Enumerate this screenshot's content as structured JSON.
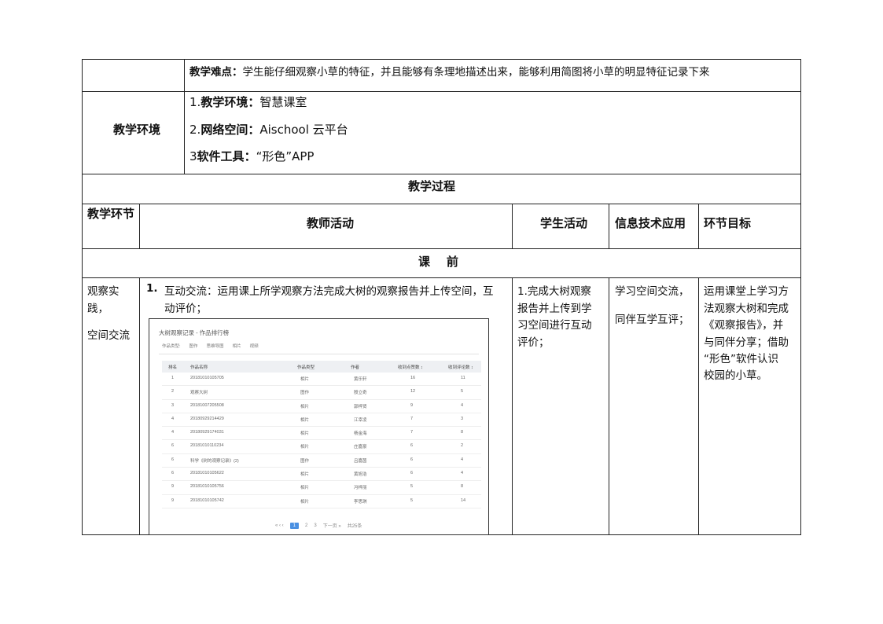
{
  "difficulty": {
    "label": "教学难点：",
    "text": "学生能仔细观察小草的特征，并且能够有条理地描述出来，能够利用简图将小草的明显特征记录下来"
  },
  "environment": {
    "header": "教学环境",
    "items": [
      {
        "prefix": "1.",
        "label": "教学环境",
        "sep": "：",
        "value": "智慧课室"
      },
      {
        "prefix": "2.",
        "label": "网络空间",
        "sep": "：",
        "value": "Aischool 云平台"
      },
      {
        "prefix": "3",
        "label": "软件工具",
        "sep": "：",
        "value": "“形色”APP"
      }
    ]
  },
  "process_title": "教学过程",
  "columns": [
    "教学环节",
    "教师活动",
    "学生活动",
    "信息技术应用",
    "环节目标"
  ],
  "section": "课    前",
  "row": {
    "stage_line1": "观察实",
    "stage_line2": "践，",
    "stage_line3": "空间交流",
    "teacher_num": "1.",
    "teacher_text_line1": "互动交流：运用课上所学观察方法完成大树的观察报告并上传空间，互",
    "teacher_text_line2": "动评价；",
    "student_lines": [
      "1.完成大树观察",
      "报告并上传到学",
      "习空间进行互动",
      "评价；"
    ],
    "tech_line1": "学习空间交流，",
    "tech_line2": "同伴互学互评；",
    "goal_lines": [
      "运用课堂上学习方",
      "法观察大树和完成",
      "《观察报告》，并",
      "与同伴分享；借助",
      "“形色”软件认识",
      "校园的小草。"
    ]
  },
  "screenshot": {
    "title": "大树观察记录 - 作品排行榜",
    "filters": [
      "作品类型:",
      "图作",
      "思维导图",
      "相片",
      "视频"
    ],
    "headers": [
      "排名",
      "作品名称",
      "作品类型",
      "作者",
      "收到点赞数 ↕",
      "收到评论数 ↕"
    ],
    "rows": [
      [
        "1",
        "20181010105705",
        "相片",
        "黄乐轩",
        "16",
        "11"
      ],
      [
        "2",
        "观察大树",
        "图作",
        "殷立奇",
        "12",
        "5"
      ],
      [
        "3",
        "20181007205508",
        "相片",
        "郭梓贤",
        "9",
        "4"
      ],
      [
        "4",
        "20180929214429",
        "相片",
        "江幸凌",
        "7",
        "3"
      ],
      [
        "4",
        "20180929174031",
        "相片",
        "杨金海",
        "7",
        "8"
      ],
      [
        "6",
        "20181010110234",
        "相片",
        "庄嘉豪",
        "6",
        "2"
      ],
      [
        "6",
        "科学《树的观察记录》(2)",
        "图作",
        "吕嘉茵",
        "6",
        "4"
      ],
      [
        "6",
        "20181010105622",
        "相片",
        "黄旭浩",
        "6",
        "4"
      ],
      [
        "9",
        "20181010105756",
        "相片",
        "冯梓丽",
        "5",
        "8"
      ],
      [
        "9",
        "20181010105742",
        "相片",
        "李思琪",
        "5",
        "14"
      ]
    ],
    "pager": {
      "prev": "« ‹ ‹",
      "pages": [
        "1",
        "2",
        "3"
      ],
      "next": "下一页 »",
      "total": "共25条"
    }
  }
}
